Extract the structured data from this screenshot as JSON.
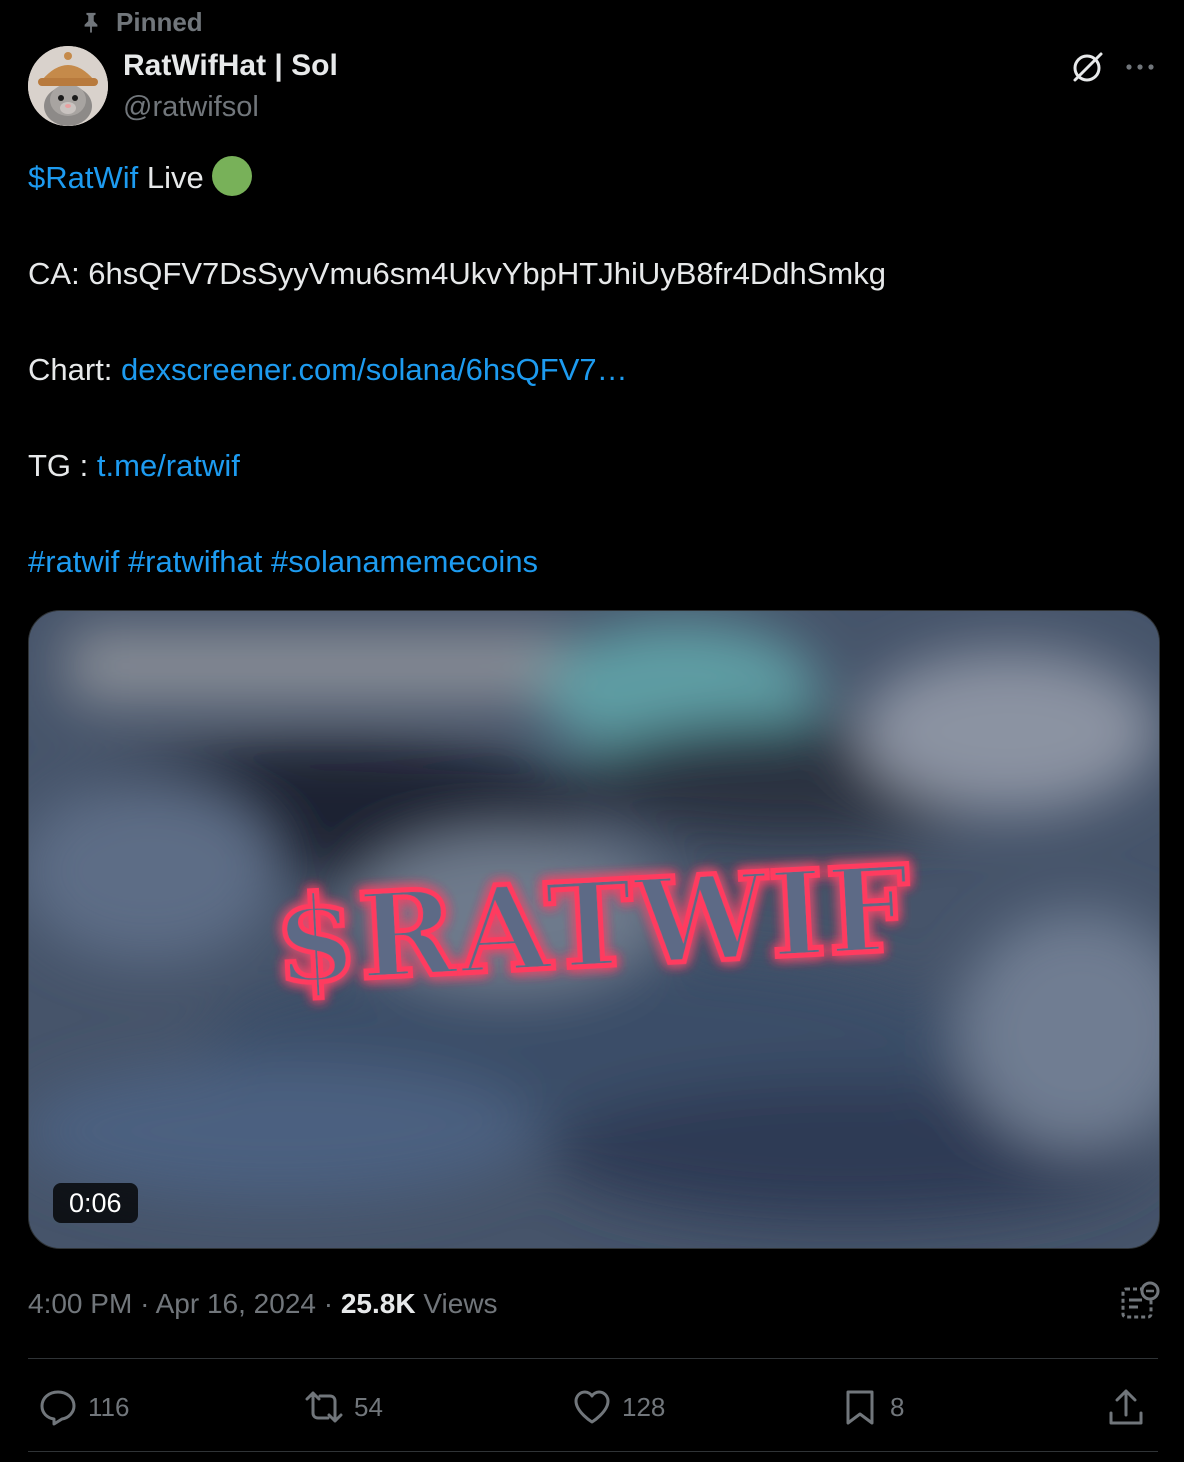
{
  "pinned_label": "Pinned",
  "author": {
    "name": "RatWifHat | Sol",
    "handle": "@ratwifsol"
  },
  "tweet": {
    "line1_link": "$RatWif",
    "line1_text": " Live",
    "ca_text": "CA: 6hsQFV7DsSyyVmu6sm4UkvYbpHTJhiUyB8fr4DdhSmkg",
    "chart_label": "Chart: ",
    "chart_link": "dexscreener.com/solana/6hsQFV7…",
    "tg_label": "TG : ",
    "tg_link": "t.me/ratwif",
    "hashtags": [
      "#ratwif",
      "#ratwifhat",
      "#solanamemecoins"
    ]
  },
  "media": {
    "overlay_text": "$RATWIF",
    "duration": "0:06"
  },
  "meta": {
    "time": "4:00 PM",
    "date": "Apr 16, 2024",
    "views_count": "25.8K",
    "views_label": "Views"
  },
  "actions": {
    "replies": "116",
    "reposts": "54",
    "likes": "128",
    "bookmarks": "8"
  },
  "colors": {
    "link": "#1d9bf0",
    "muted": "#71767b",
    "text": "#e7e9ea",
    "live_dot": "#78b159",
    "neon": "#ff2a55"
  }
}
